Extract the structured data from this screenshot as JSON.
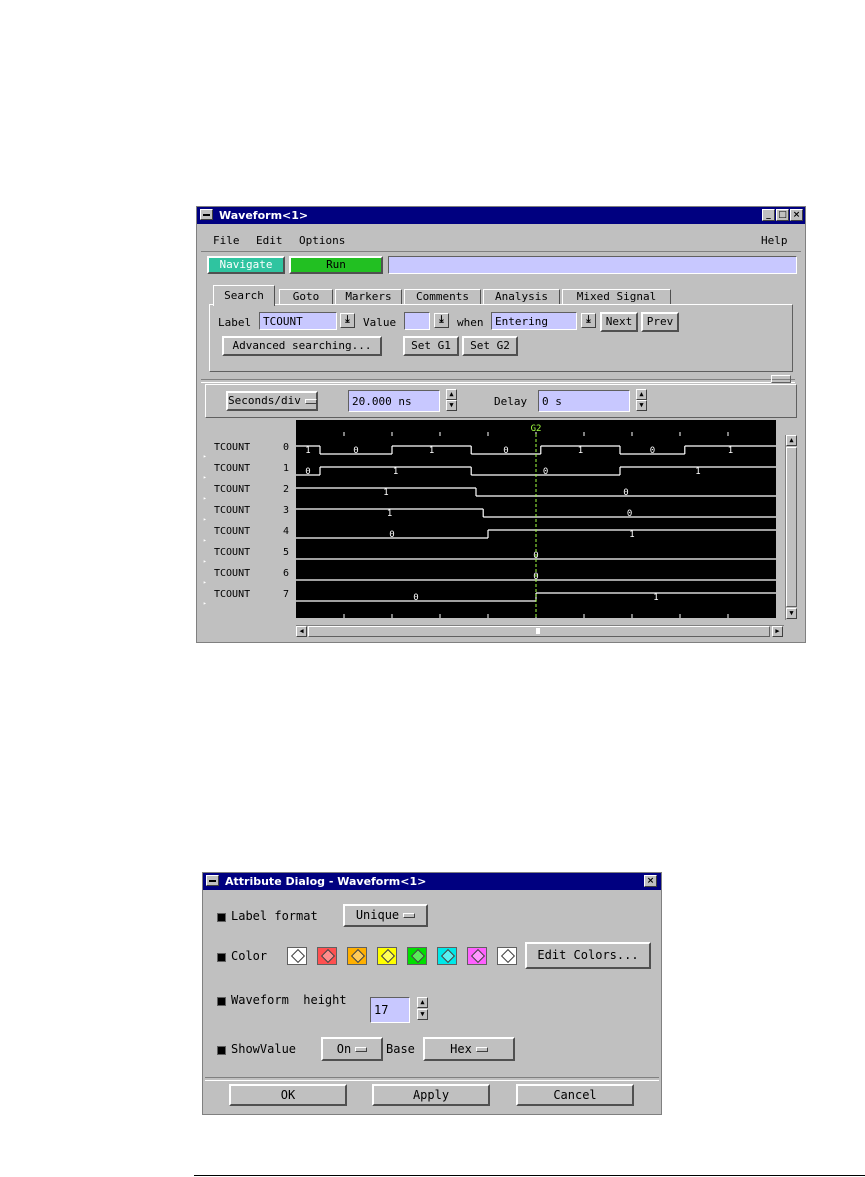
{
  "waveform": {
    "title": "Waveform<1>",
    "title_buttons": [
      "_",
      "□",
      "×"
    ],
    "menu": [
      "File",
      "Edit",
      "Options"
    ],
    "help": "Help",
    "navigate_label": "Navigate",
    "run_label": "Run",
    "tabs": [
      "Search",
      "Goto",
      "Markers",
      "Comments",
      "Analysis",
      "Mixed Signal"
    ],
    "search": {
      "label_text": "Label",
      "label_value": "TCOUNT",
      "value_text": "Value",
      "value_value": "",
      "when_text": "when",
      "when_value": "Entering",
      "next_label": "Next",
      "prev_label": "Prev",
      "advanced_label": "Advanced searching...",
      "set_g1_label": "Set G1",
      "set_g2_label": "Set G2"
    },
    "timebase": {
      "seconds_div_label": "Seconds/div",
      "seconds_div_value": "20.000 ns",
      "delay_label": "Delay",
      "delay_value": "0 s"
    },
    "marker_label": "G2",
    "signals": [
      {
        "name": "TCOUNT",
        "bit": "0",
        "segments": [
          {
            "v": "1",
            "from": 0,
            "to": 0.05
          },
          {
            "v": "0",
            "from": 0.05,
            "to": 0.2
          },
          {
            "v": "1",
            "from": 0.2,
            "to": 0.365
          },
          {
            "v": "0",
            "from": 0.365,
            "to": 0.51
          },
          {
            "v": "1",
            "from": 0.51,
            "to": 0.675
          },
          {
            "v": "0",
            "from": 0.675,
            "to": 0.81
          },
          {
            "v": "1",
            "from": 0.81,
            "to": 1.0
          }
        ]
      },
      {
        "name": "TCOUNT",
        "bit": "1",
        "segments": [
          {
            "v": "0",
            "from": 0,
            "to": 0.05
          },
          {
            "v": "1",
            "from": 0.05,
            "to": 0.365
          },
          {
            "v": "0",
            "from": 0.365,
            "to": 0.675
          },
          {
            "v": "1",
            "from": 0.675,
            "to": 1.0
          }
        ]
      },
      {
        "name": "TCOUNT",
        "bit": "2",
        "segments": [
          {
            "v": "1",
            "from": 0,
            "to": 0.375
          },
          {
            "v": "0",
            "from": 0.375,
            "to": 1.0
          }
        ]
      },
      {
        "name": "TCOUNT",
        "bit": "3",
        "segments": [
          {
            "v": "1",
            "from": 0,
            "to": 0.39
          },
          {
            "v": "0",
            "from": 0.39,
            "to": 1.0
          }
        ]
      },
      {
        "name": "TCOUNT",
        "bit": "4",
        "segments": [
          {
            "v": "0",
            "from": 0,
            "to": 0.4
          },
          {
            "v": "1",
            "from": 0.4,
            "to": 1.0
          }
        ]
      },
      {
        "name": "TCOUNT",
        "bit": "5",
        "segments": [
          {
            "v": "0",
            "from": 0,
            "to": 1.0
          }
        ]
      },
      {
        "name": "TCOUNT",
        "bit": "6",
        "segments": [
          {
            "v": "0",
            "from": 0,
            "to": 1.0
          }
        ]
      },
      {
        "name": "TCOUNT",
        "bit": "7",
        "segments": [
          {
            "v": "0",
            "from": 0,
            "to": 0.5
          },
          {
            "v": "1",
            "from": 0.5,
            "to": 1.0
          }
        ]
      }
    ]
  },
  "attr": {
    "title": "Attribute Dialog - Waveform<1>",
    "close_glyph": "×",
    "label_format_label": "Label format",
    "label_format_value": "Unique",
    "color_label": "Color",
    "swatches": [
      "#ffffff",
      "#ff5050",
      "#ffb000",
      "#ffff00",
      "#00e000",
      "#00e8e8",
      "#ff60ff",
      "#ffffff"
    ],
    "edit_colors_label": "Edit Colors...",
    "waveform_height_label": "Waveform  height",
    "waveform_height_value": "17",
    "showvalue_label": "ShowValue",
    "showvalue_value": "On",
    "base_label": "Base",
    "base_value": "Hex",
    "ok_label": "OK",
    "apply_label": "Apply",
    "cancel_label": "Cancel"
  },
  "colors": {
    "navigate": "#2fc4a0",
    "run": "#22c022",
    "marker": "#a0ff40",
    "wave": "#ffffff"
  }
}
